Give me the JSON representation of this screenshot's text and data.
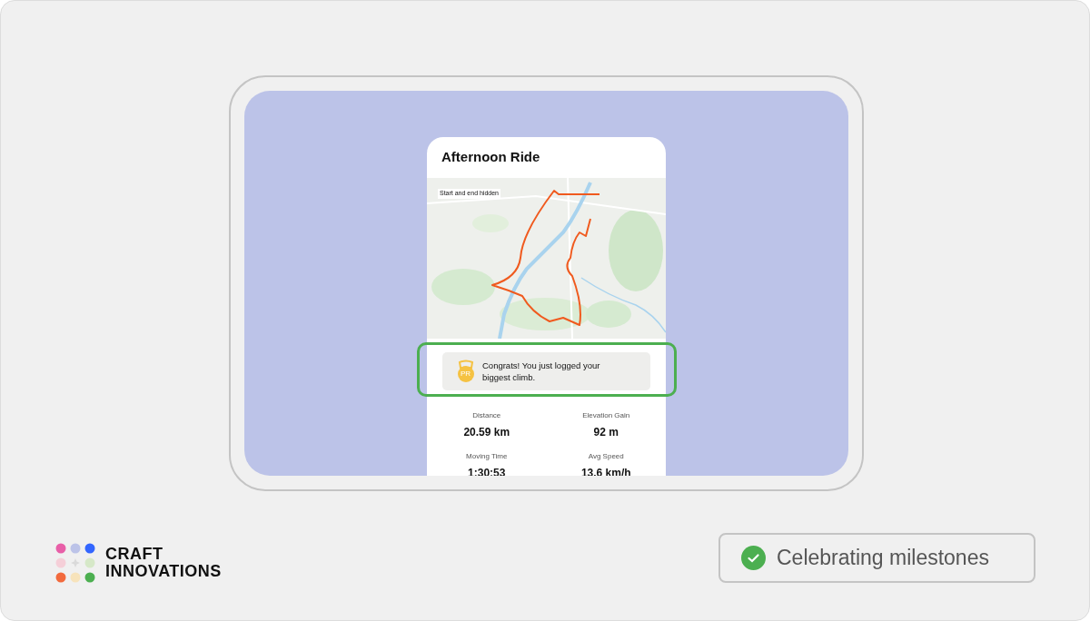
{
  "card": {
    "title": "Afternoon Ride",
    "map_note": "Start and end hidden",
    "highlighted": true,
    "achievement": {
      "badge": "PR",
      "text": "Congrats! You just logged your biggest climb."
    },
    "stats": [
      {
        "label": "Distance",
        "value": "20.59 km"
      },
      {
        "label": "Elevation Gain",
        "value": "92 m"
      },
      {
        "label": "Moving Time",
        "value": "1:30:53"
      },
      {
        "label": "Avg Speed",
        "value": "13.6 km/h"
      }
    ]
  },
  "brand": {
    "lines": [
      "CRAFT",
      "INNOVATIONS"
    ]
  },
  "caption": {
    "text": "Celebrating milestones",
    "checked": true
  }
}
